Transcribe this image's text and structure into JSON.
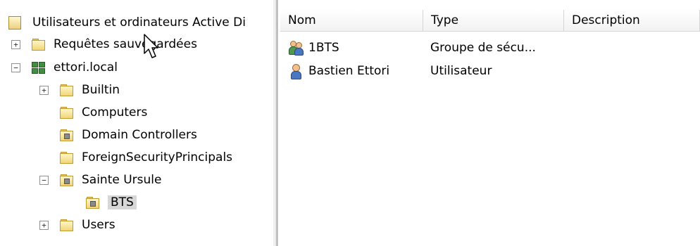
{
  "tree": {
    "root_label": "Utilisateurs et ordinateurs Active Di",
    "items": [
      {
        "label": "Requêtes sauvegardées",
        "expander": "+"
      },
      {
        "label": "ettori.local",
        "expander": "−"
      },
      {
        "label": "Builtin",
        "expander": "+"
      },
      {
        "label": "Computers",
        "expander": ""
      },
      {
        "label": "Domain Controllers",
        "expander": ""
      },
      {
        "label": "ForeignSecurityPrincipals",
        "expander": ""
      },
      {
        "label": "Sainte Ursule",
        "expander": "−"
      },
      {
        "label": "BTS",
        "expander": ""
      },
      {
        "label": "Users",
        "expander": "+"
      }
    ]
  },
  "list": {
    "columns": [
      "Nom",
      "Type",
      "Description"
    ],
    "rows": [
      {
        "name": "1BTS",
        "type": "Groupe de sécu...",
        "icon": "group-icon"
      },
      {
        "name": "Bastien Ettori",
        "type": "Utilisateur",
        "icon": "user-icon"
      }
    ]
  },
  "colors": {
    "selection": "#d7d7d7",
    "folder": "#f2d676",
    "domain": "#3f8f3f"
  }
}
